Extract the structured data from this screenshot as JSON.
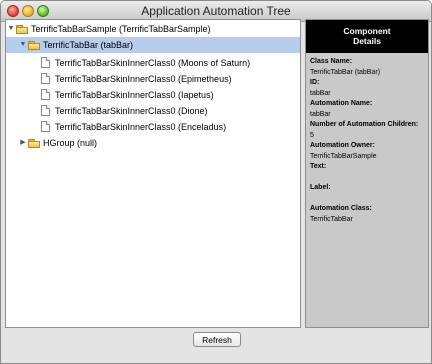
{
  "window": {
    "title": "Application Automation Tree"
  },
  "tree": {
    "items": [
      {
        "label": "TerrificTabBarSample (TerrificTabBarSample)"
      },
      {
        "label": "TerrificTabBar (tabBar)"
      },
      {
        "label": "TerrificTabBarSkinInnerClass0 (Moons of Saturn)"
      },
      {
        "label": "TerrificTabBarSkinInnerClass0 (Epimetheus)"
      },
      {
        "label": "TerrificTabBarSkinInnerClass0 (Iapetus)"
      },
      {
        "label": "TerrificTabBarSkinInnerClass0 (Dione)"
      },
      {
        "label": "TerrificTabBarSkinInnerClass0 (Enceladus)"
      },
      {
        "label": "HGroup (null)"
      }
    ]
  },
  "details": {
    "header_line1": "Component",
    "header_line2": "Details",
    "class_name_label": "Class Name:",
    "class_name_value": "TerrificTabBar (tabBar)",
    "id_label": "ID:",
    "id_value": "tabBar",
    "automation_name_label": "Automation Name:",
    "automation_name_value": "tabBar",
    "children_label": "Number of Automation Children:",
    "children_value": "5",
    "owner_label": "Automation Owner:",
    "owner_value": "TerrificTabBarSample",
    "text_label": "Text:",
    "label_label": "Label:",
    "class_label": "Automation Class:",
    "class_value": "TerrificTabBar"
  },
  "buttons": {
    "refresh": "Refresh"
  }
}
